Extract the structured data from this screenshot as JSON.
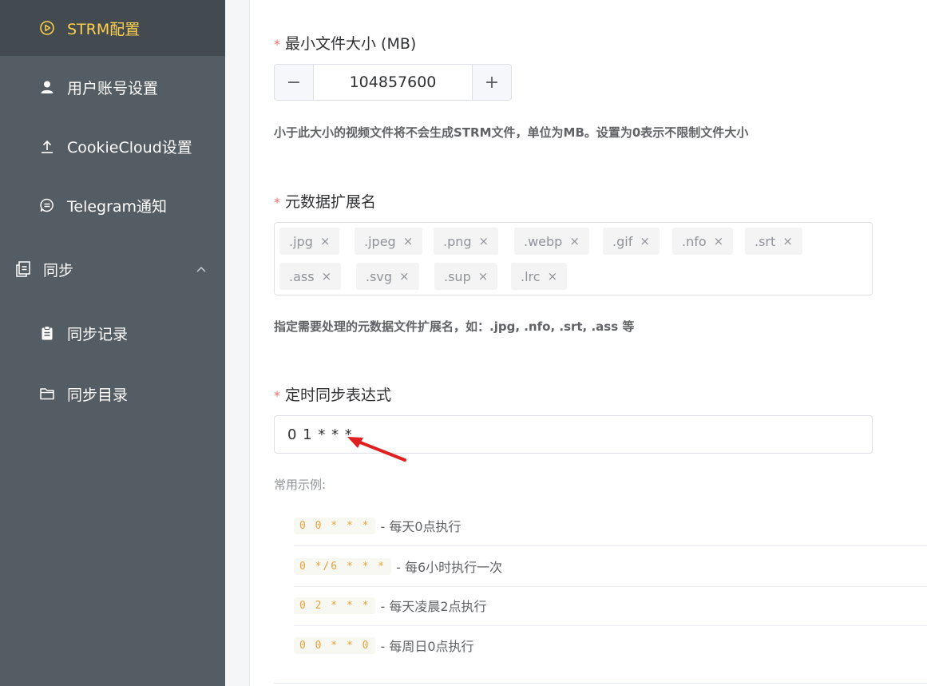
{
  "sidebar": {
    "items": [
      {
        "label": "STRM配置",
        "icon": "play-circle-icon"
      },
      {
        "label": "用户账号设置",
        "icon": "user-icon"
      },
      {
        "label": "CookieCloud设置",
        "icon": "upload-icon"
      },
      {
        "label": "Telegram通知",
        "icon": "chat-bubble-icon"
      },
      {
        "label": "同步",
        "icon": "copy-icon"
      },
      {
        "label": "同步记录",
        "icon": "clipboard-icon"
      },
      {
        "label": "同步目录",
        "icon": "folder-icon"
      }
    ],
    "active_color": "#ffd04b",
    "background": "#545c64"
  },
  "form": {
    "min_size": {
      "required_mark": "*",
      "label": "最小文件大小 (MB)",
      "value": "104857600",
      "minus": "−",
      "plus": "+",
      "help": "小于此大小的视频文件将不会生成STRM文件，单位为MB。设置为0表示不限制文件大小"
    },
    "meta_ext": {
      "required_mark": "*",
      "label": "元数据扩展名",
      "tags": [
        ".jpg",
        ".jpeg",
        ".png",
        ".webp",
        ".gif",
        ".nfo",
        ".srt",
        ".ass",
        ".svg",
        ".sup",
        ".lrc"
      ],
      "remove_glyph": "×",
      "help": "指定需要处理的元数据文件扩展名，如：.jpg, .nfo, .srt, .ass 等"
    },
    "cron": {
      "required_mark": "*",
      "label": "定时同步表达式",
      "value": "0 1 * * *",
      "examples_title": "常用示例:",
      "examples": [
        {
          "code": "0 0 * * *",
          "desc": "- 每天0点执行"
        },
        {
          "code": "0 */6 * * *",
          "desc": "- 每6小时执行一次"
        },
        {
          "code": "0 2 * * *",
          "desc": "- 每天凌晨2点执行"
        },
        {
          "code": "0 0 * * 0",
          "desc": "- 每周日0点执行"
        }
      ]
    }
  },
  "colors": {
    "required": "#f56c6c",
    "code_text": "#e6a23c",
    "arrow": "#e02020"
  }
}
